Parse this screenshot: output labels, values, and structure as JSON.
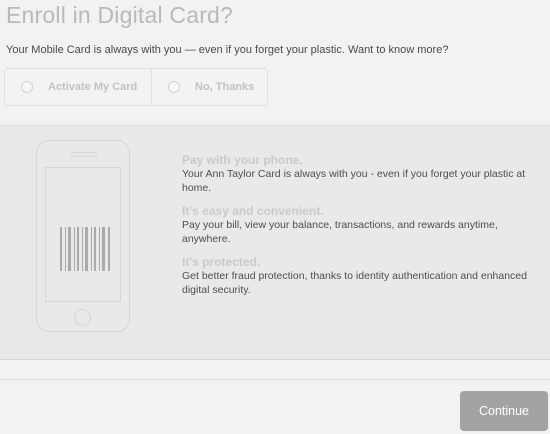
{
  "header": {
    "title": "Enroll in Digital Card?",
    "subtitle": "Your Mobile Card is always with you — even if you forget your plastic. Want to know more?"
  },
  "choices": [
    {
      "label": "Activate My Card",
      "selected": false
    },
    {
      "label": "No, Thanks",
      "selected": false
    }
  ],
  "features": [
    {
      "title": "Pay with your phone.",
      "text": "Your Ann Taylor Card is always with you - even if you forget your plastic at home."
    },
    {
      "title": "It's easy and convenient.",
      "text": "Pay your bill, view your balance, transactions, and rewards anytime, anywhere."
    },
    {
      "title": "It's protected.",
      "text": "Get better fraud protection, thanks to identity authentication and enhanced digital security."
    }
  ],
  "footer": {
    "continue_label": "Continue"
  },
  "illustration": {
    "icon": "phone-barcode-icon"
  },
  "colors": {
    "background": "#f2f2f2",
    "panel": "#e9e9e9",
    "button": "#a3a3a3"
  }
}
